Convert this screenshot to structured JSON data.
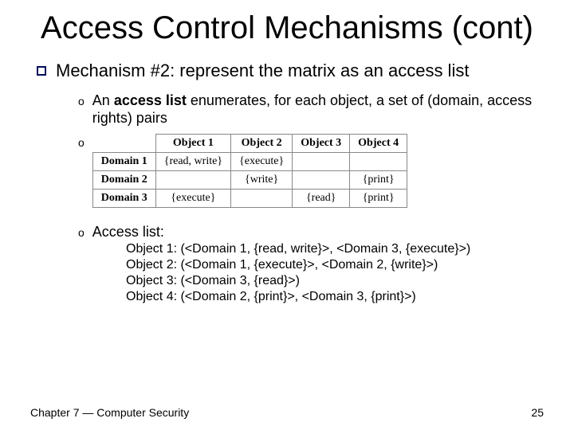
{
  "title": "Access Control Mechanisms (cont)",
  "mechanism": {
    "intro": "Mechanism #2: represent the matrix as an access list",
    "sub1_pre": "An ",
    "sub1_bold": "access list",
    "sub1_post": " enumerates, for each object, a set of (domain, access rights) pairs"
  },
  "table": {
    "cols": [
      "Object 1",
      "Object 2",
      "Object 3",
      "Object 4"
    ],
    "rows": [
      {
        "label": "Domain 1",
        "cells": [
          "{read, write}",
          "{execute}",
          "",
          ""
        ]
      },
      {
        "label": "Domain 2",
        "cells": [
          "",
          "{write}",
          "",
          "{print}"
        ]
      },
      {
        "label": "Domain 3",
        "cells": [
          "{execute}",
          "",
          "{read}",
          "{print}"
        ]
      }
    ]
  },
  "access_list": {
    "intro": "Access list:",
    "items": [
      "Object 1: (<Domain 1, {read, write}>, <Domain 3, {execute}>)",
      "Object 2: (<Domain 1, {execute}>, <Domain 2, {write}>)",
      "Object 3: (<Domain 3, {read}>)",
      "Object 4: (<Domain 2, {print}>, <Domain 3, {print}>)"
    ]
  },
  "footer": {
    "left": "Chapter 7 — Computer Security",
    "right": "25"
  }
}
